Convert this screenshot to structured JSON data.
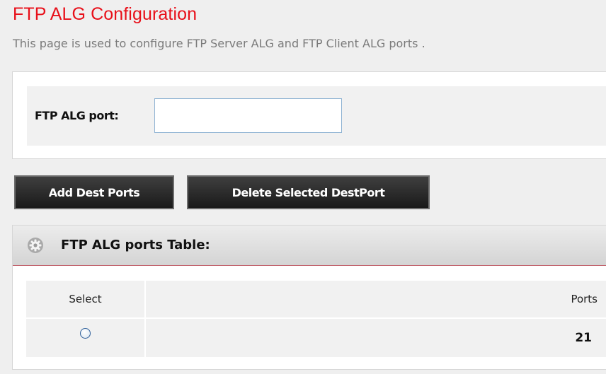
{
  "page": {
    "title": "FTP ALG Configuration",
    "description": "This page is used to configure FTP Server ALG and FTP Client ALG ports ."
  },
  "form": {
    "port_label": "FTP ALG port:",
    "port_value": ""
  },
  "buttons": {
    "add": "Add Dest Ports",
    "delete": "Delete Selected DestPort"
  },
  "table": {
    "title": "FTP ALG ports Table:",
    "icon": "gear-icon",
    "columns": [
      "Select",
      "Ports"
    ],
    "rows": [
      {
        "selected": false,
        "port": "21"
      }
    ]
  },
  "colors": {
    "title": "#e8101a",
    "button_bg": "#1a1a1a",
    "header_separator": "#c0606a"
  }
}
